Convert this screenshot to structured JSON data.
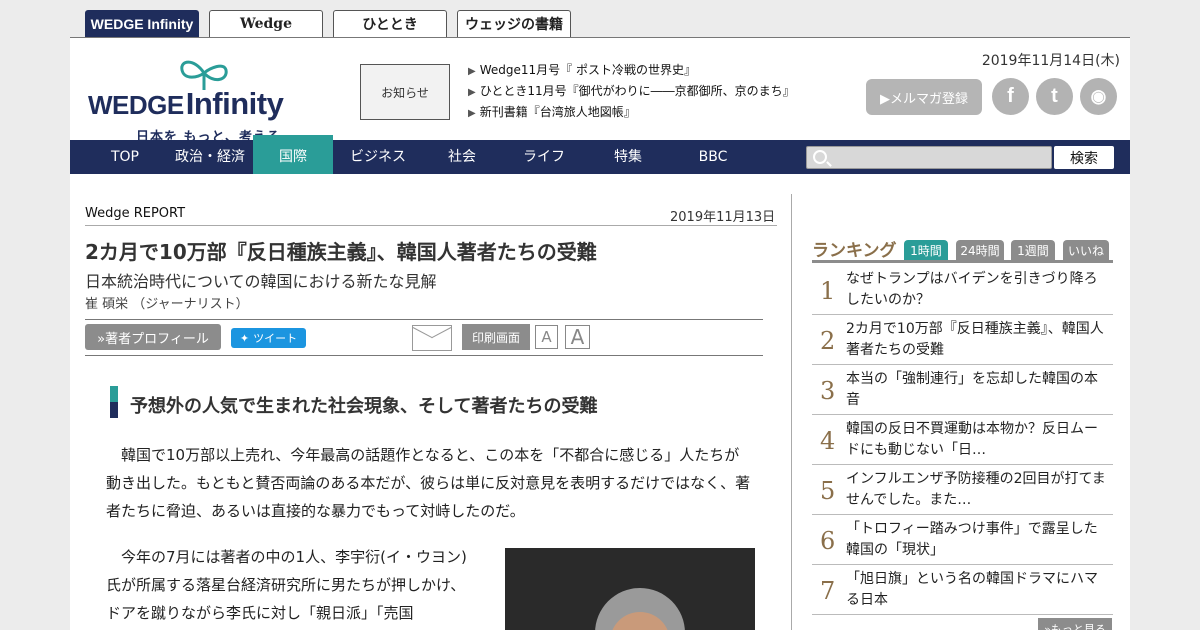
{
  "site_tabs": [
    {
      "label": "WEDGE Infinity"
    },
    {
      "label": "Wedge"
    },
    {
      "label": "ひととき"
    },
    {
      "label": "ウェッジの書籍"
    }
  ],
  "header": {
    "logo_main": "WEDGE",
    "logo_inf": "Infinity",
    "logo_sub": "日本を もっと、考える",
    "notice_label": "お知らせ",
    "news": [
      "Wedge11月号『 ポスト冷戦の世界史』",
      "ひととき11月号『御代がわりに――京都御所、京のまち』",
      "新刊書籍『台湾旅人地図帳』"
    ],
    "date": "2019年11月14日(木)",
    "mailmag_label": "▶メルマガ登録",
    "social": [
      {
        "name": "facebook-icon",
        "glyph": "f"
      },
      {
        "name": "twitter-icon",
        "glyph": "t"
      },
      {
        "name": "rss-icon",
        "glyph": "◉"
      }
    ]
  },
  "nav": {
    "items": [
      "TOP",
      "政治・経済",
      "国際",
      "ビジネス",
      "社会",
      "ライフ",
      "特集",
      "BBC"
    ],
    "active_index": 2,
    "search_placeholder": "",
    "search_label": "検索"
  },
  "article": {
    "category": "Wedge REPORT",
    "date": "2019年11月13日",
    "title": "2カ月で10万部『反日種族主義』、韓国人著者たちの受難",
    "subtitle": "日本統治時代についての韓国における新たな見解",
    "author": "崔 碩栄 （ジャーナリスト）",
    "profile_label": "»著者プロフィール",
    "tweet_label": "ツイート",
    "print_label": "印刷画面",
    "font_small": "A",
    "font_large": "A",
    "section_heading": "予想外の人気で生まれた社会現象、そして著者たちの受難",
    "para1": "韓国で10万部以上売れ、今年最高の話題作となると、この本を「不都合に感じる」人たちが動き出した。もともと賛否両論のある本だが、彼らは単に反対意見を表明するだけではなく、著者たちに脅迫、あるいは直接的な暴力でもって対峙したのだ。",
    "para2": "今年の7月には著者の中の1人、李宇衍(イ・ウヨン)氏が所属する落星台経済研究所に男たちが押しかけ、ドアを蹴りながら李氏に対し「親日派」「売国"
  },
  "ranking": {
    "heading": "ランキング",
    "tabs": [
      "1時間",
      "24時間",
      "1週間",
      "いいね"
    ],
    "active_tab": 0,
    "items": [
      {
        "num": "1",
        "text": "なぜトランプはバイデンを引きづり降ろしたいのか？"
      },
      {
        "num": "2",
        "text": "2カ月で10万部『反日種族主義』、韓国人著者たちの受難"
      },
      {
        "num": "3",
        "text": "本当の「強制連行」を忘却した韓国の本音"
      },
      {
        "num": "4",
        "text": "韓国の反日不買運動は本物か？反日ムードにも動じない「日…"
      },
      {
        "num": "5",
        "text": "インフルエンザ予防接種の2回目が打てませんでした。また…"
      },
      {
        "num": "6",
        "text": "「トロフィー踏みつけ事件」で露呈した韓国の「現状」"
      },
      {
        "num": "7",
        "text": "「旭日旗」という名の韓国ドラマにハマる日本"
      }
    ],
    "more_label": "»もっと見る"
  }
}
